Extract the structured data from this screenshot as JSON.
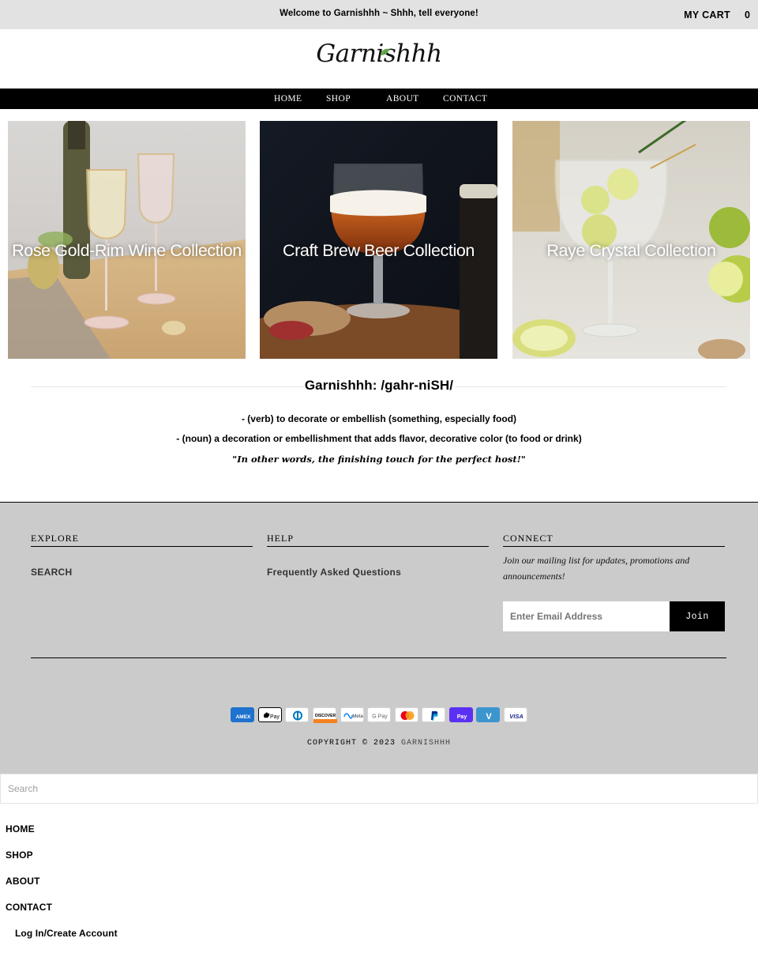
{
  "announcement": {
    "message": "Welcome to Garnishhh ~ Shhh, tell everyone!",
    "cart_label": "MY CART",
    "cart_count": "0"
  },
  "brand": {
    "logo_text": "Garnishhh",
    "leaf_color": "#6aa84f"
  },
  "nav": {
    "items": [
      "HOME",
      "SHOP",
      "ABOUT",
      "CONTACT"
    ],
    "background": "#000000"
  },
  "collections": [
    {
      "title": "Rose Gold-Rim Wine Collection"
    },
    {
      "title": "Craft Brew Beer Collection"
    },
    {
      "title": "Raye Crystal Collection"
    }
  ],
  "definition": {
    "heading": "Garnishhh: /gahr-niSH/",
    "verb": "- (verb) to decorate or embellish (something, especially food)",
    "noun": "- (noun) a decoration or embellishment that adds flavor, decorative color (to food or drink)",
    "quote": "\"In other words, the finishing touch for the perfect host!\""
  },
  "footer": {
    "background": "#cbcbcb",
    "explore": {
      "title": "EXPLORE",
      "links": [
        "SEARCH"
      ]
    },
    "help": {
      "title": "HELP",
      "links": [
        "Frequently Asked Questions"
      ]
    },
    "connect": {
      "title": "CONNECT",
      "note": "Join our mailing list for updates, promotions and announcements!",
      "email_placeholder": "Enter Email Address",
      "join_label": "Join"
    },
    "payment_icons": [
      "amex-icon",
      "apple-pay-icon",
      "diners-club-icon",
      "discover-icon",
      "meta-pay-icon",
      "google-pay-icon",
      "mastercard-icon",
      "paypal-icon",
      "shop-pay-icon",
      "venmo-icon",
      "visa-icon"
    ],
    "payment_labels": {
      "amex": "AMEX",
      "apple_pay": "Pay",
      "discover": "DISCOVER",
      "meta": "Meta",
      "google_pay": "G Pay",
      "shop_pay": "Pay",
      "venmo": "V",
      "visa": "VISA"
    },
    "copyright_prefix": "COPYRIGHT © 2023",
    "copyright_brand": "GARNISHHH"
  },
  "drawer": {
    "search_placeholder": "Search",
    "items": [
      "HOME",
      "SHOP",
      "ABOUT",
      "CONTACT"
    ],
    "login_label": "Log In/Create Account"
  }
}
